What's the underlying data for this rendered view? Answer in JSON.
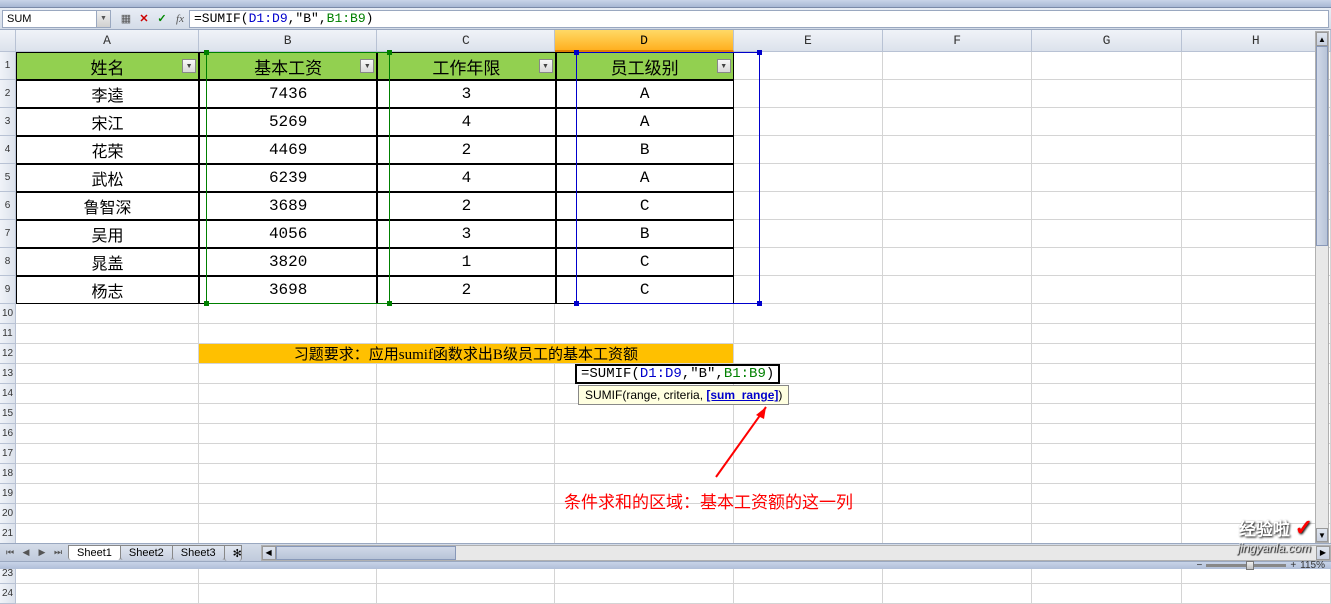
{
  "name_box": "SUM",
  "formula": {
    "prefix": "=SUMIF(",
    "ref1": "D1:D9",
    "mid": ",\"B\",",
    "ref2": "B1:B9",
    "suffix": ")"
  },
  "columns": [
    "A",
    "B",
    "C",
    "D",
    "E",
    "F",
    "G",
    "H"
  ],
  "active_col": "D",
  "headers": {
    "A": "姓名",
    "B": "基本工资",
    "C": "工作年限",
    "D": "员工级别"
  },
  "rows": [
    {
      "A": "李逵",
      "B": "7436",
      "C": "3",
      "D": "A"
    },
    {
      "A": "宋江",
      "B": "5269",
      "C": "4",
      "D": "A"
    },
    {
      "A": "花荣",
      "B": "4469",
      "C": "2",
      "D": "B"
    },
    {
      "A": "武松",
      "B": "6239",
      "C": "4",
      "D": "A"
    },
    {
      "A": "鲁智深",
      "B": "3689",
      "C": "2",
      "D": "C"
    },
    {
      "A": "吴用",
      "B": "4056",
      "C": "3",
      "D": "B"
    },
    {
      "A": "晁盖",
      "B": "3820",
      "C": "1",
      "D": "C"
    },
    {
      "A": "杨志",
      "B": "3698",
      "C": "2",
      "D": "C"
    }
  ],
  "note": "习题要求：应用sumif函数求出B级员工的基本工资额",
  "tooltip": {
    "pre": "SUMIF(range, criteria, ",
    "bold": "[sum_range]",
    "post": ")"
  },
  "annotation": "条件求和的区域：基本工资额的这一列",
  "sheets": [
    "Sheet1",
    "Sheet2",
    "Sheet3"
  ],
  "active_sheet": "Sheet1",
  "zoom": "115%",
  "watermark": "经验啦",
  "watermark_sub": "jingyanla.com"
}
